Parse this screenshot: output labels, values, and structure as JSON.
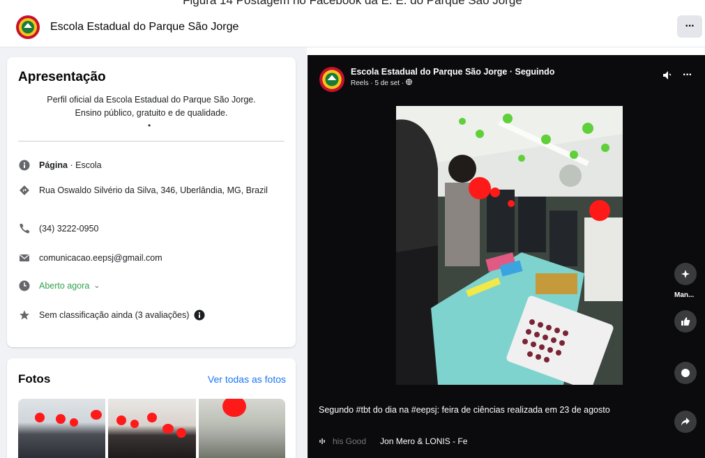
{
  "top_caption": "Figura 14 Postagem no Facebook da E. E. do Parque São Jorge",
  "header": {
    "page_name": "Escola Estadual do Parque São Jorge",
    "more_label": "···"
  },
  "intro": {
    "title": "Apresentação",
    "bio_line1": "Perfil oficial da Escola Estadual do Parque São Jorge.",
    "bio_line2": "Ensino público, gratuito e de qualidade.",
    "bio_dot": "•",
    "category_bold": "Página",
    "category_rest": " · Escola",
    "address": "Rua Oswaldo Silvério da Silva, 346, Uberlândia, MG, Brazil",
    "phone": "(34) 3222-0950",
    "email": "comunicacao.eepsj@gmail.com",
    "hours": "Aberto agora",
    "hours_chevron": "⌄",
    "rating": "Sem classificação ainda (3 avaliações)"
  },
  "photos": {
    "title": "Fotos",
    "see_all": "Ver todas as fotos"
  },
  "reel": {
    "author": "Escola Estadual do Parque São Jorge · Seguindo",
    "meta": "Reels · 5 de set · ",
    "more_label": "···",
    "side_label": "Man...",
    "caption": "Segundo #tbt do dia na #eepsj: feira de ciências realizada em 23 de agosto",
    "music_faded": "his Good",
    "music_artist": "Jon Mero & LONIS - Fe"
  },
  "colors": {
    "link": "#1877f2",
    "open": "#31a24c",
    "reel_bg": "#0b0b0d",
    "page_bg": "#f0f2f5"
  }
}
